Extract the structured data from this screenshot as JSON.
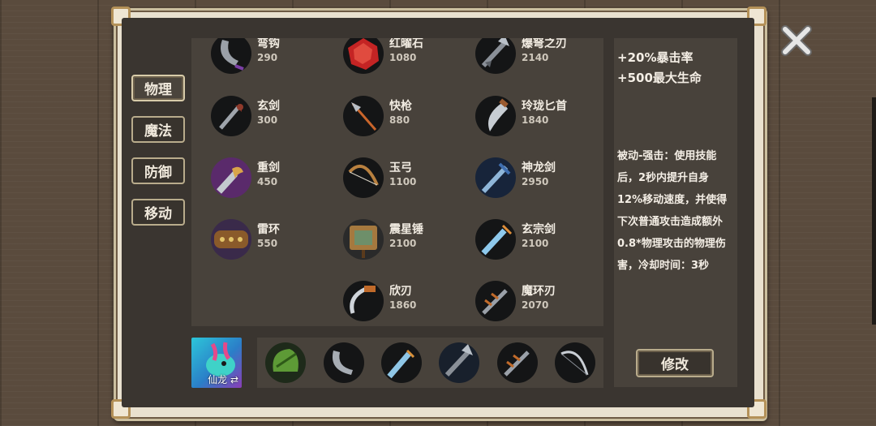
{
  "side_tabs": [
    {
      "label": "物理",
      "active": true
    },
    {
      "label": "魔法",
      "active": false
    },
    {
      "label": "防御",
      "active": false
    },
    {
      "label": "移动",
      "active": false
    }
  ],
  "items": [
    {
      "name": "弯钩",
      "price": "290",
      "icon": "hook-blade-icon"
    },
    {
      "name": "红曜石",
      "price": "1080",
      "icon": "red-gem-icon"
    },
    {
      "name": "爆弩之刃",
      "price": "2140",
      "icon": "crossbow-blade-icon"
    },
    {
      "name": "玄剑",
      "price": "300",
      "icon": "dark-sword-icon"
    },
    {
      "name": "快枪",
      "price": "880",
      "icon": "spear-icon"
    },
    {
      "name": "玲珑匕首",
      "price": "1840",
      "icon": "dagger-icon"
    },
    {
      "name": "重剑",
      "price": "450",
      "icon": "heavy-sword-icon"
    },
    {
      "name": "玉弓",
      "price": "1100",
      "icon": "bow-icon"
    },
    {
      "name": "神龙剑",
      "price": "2950",
      "icon": "dragon-sword-icon"
    },
    {
      "name": "雷环",
      "price": "550",
      "icon": "thunder-ring-icon"
    },
    {
      "name": "震星锤",
      "price": "2100",
      "icon": "hammer-icon"
    },
    {
      "name": "玄宗剑",
      "price": "2100",
      "icon": "sect-sword-icon"
    },
    {
      "name": "欣刃",
      "price": "1860",
      "icon": "curved-blade-icon"
    },
    {
      "name": "魔环刃",
      "price": "2070",
      "icon": "demon-blade-icon"
    }
  ],
  "info": {
    "stat1": "+20%暴击率",
    "stat2": "+500最大生命",
    "description": "被动-强击：使用技能后，2秒内提升自身12%移动速度，并使得下次普通攻击造成额外0.8*物理攻击的物理伤害，冷却时间：3秒",
    "modify_label": "修改"
  },
  "hero": {
    "name": "仙龙",
    "swap_symbol": "⇄"
  },
  "equipped": [
    {
      "icon": "green-armor-icon"
    },
    {
      "icon": "hook-blade-icon"
    },
    {
      "icon": "dagger-icon"
    },
    {
      "icon": "crossbow-blade-icon"
    },
    {
      "icon": "demon-blade-icon"
    },
    {
      "icon": "bow-icon"
    }
  ],
  "colors": {
    "panel": "#3a3530",
    "tile": "#48423b",
    "frame": "#e9e1cf",
    "accent": "#b9ac8c"
  }
}
